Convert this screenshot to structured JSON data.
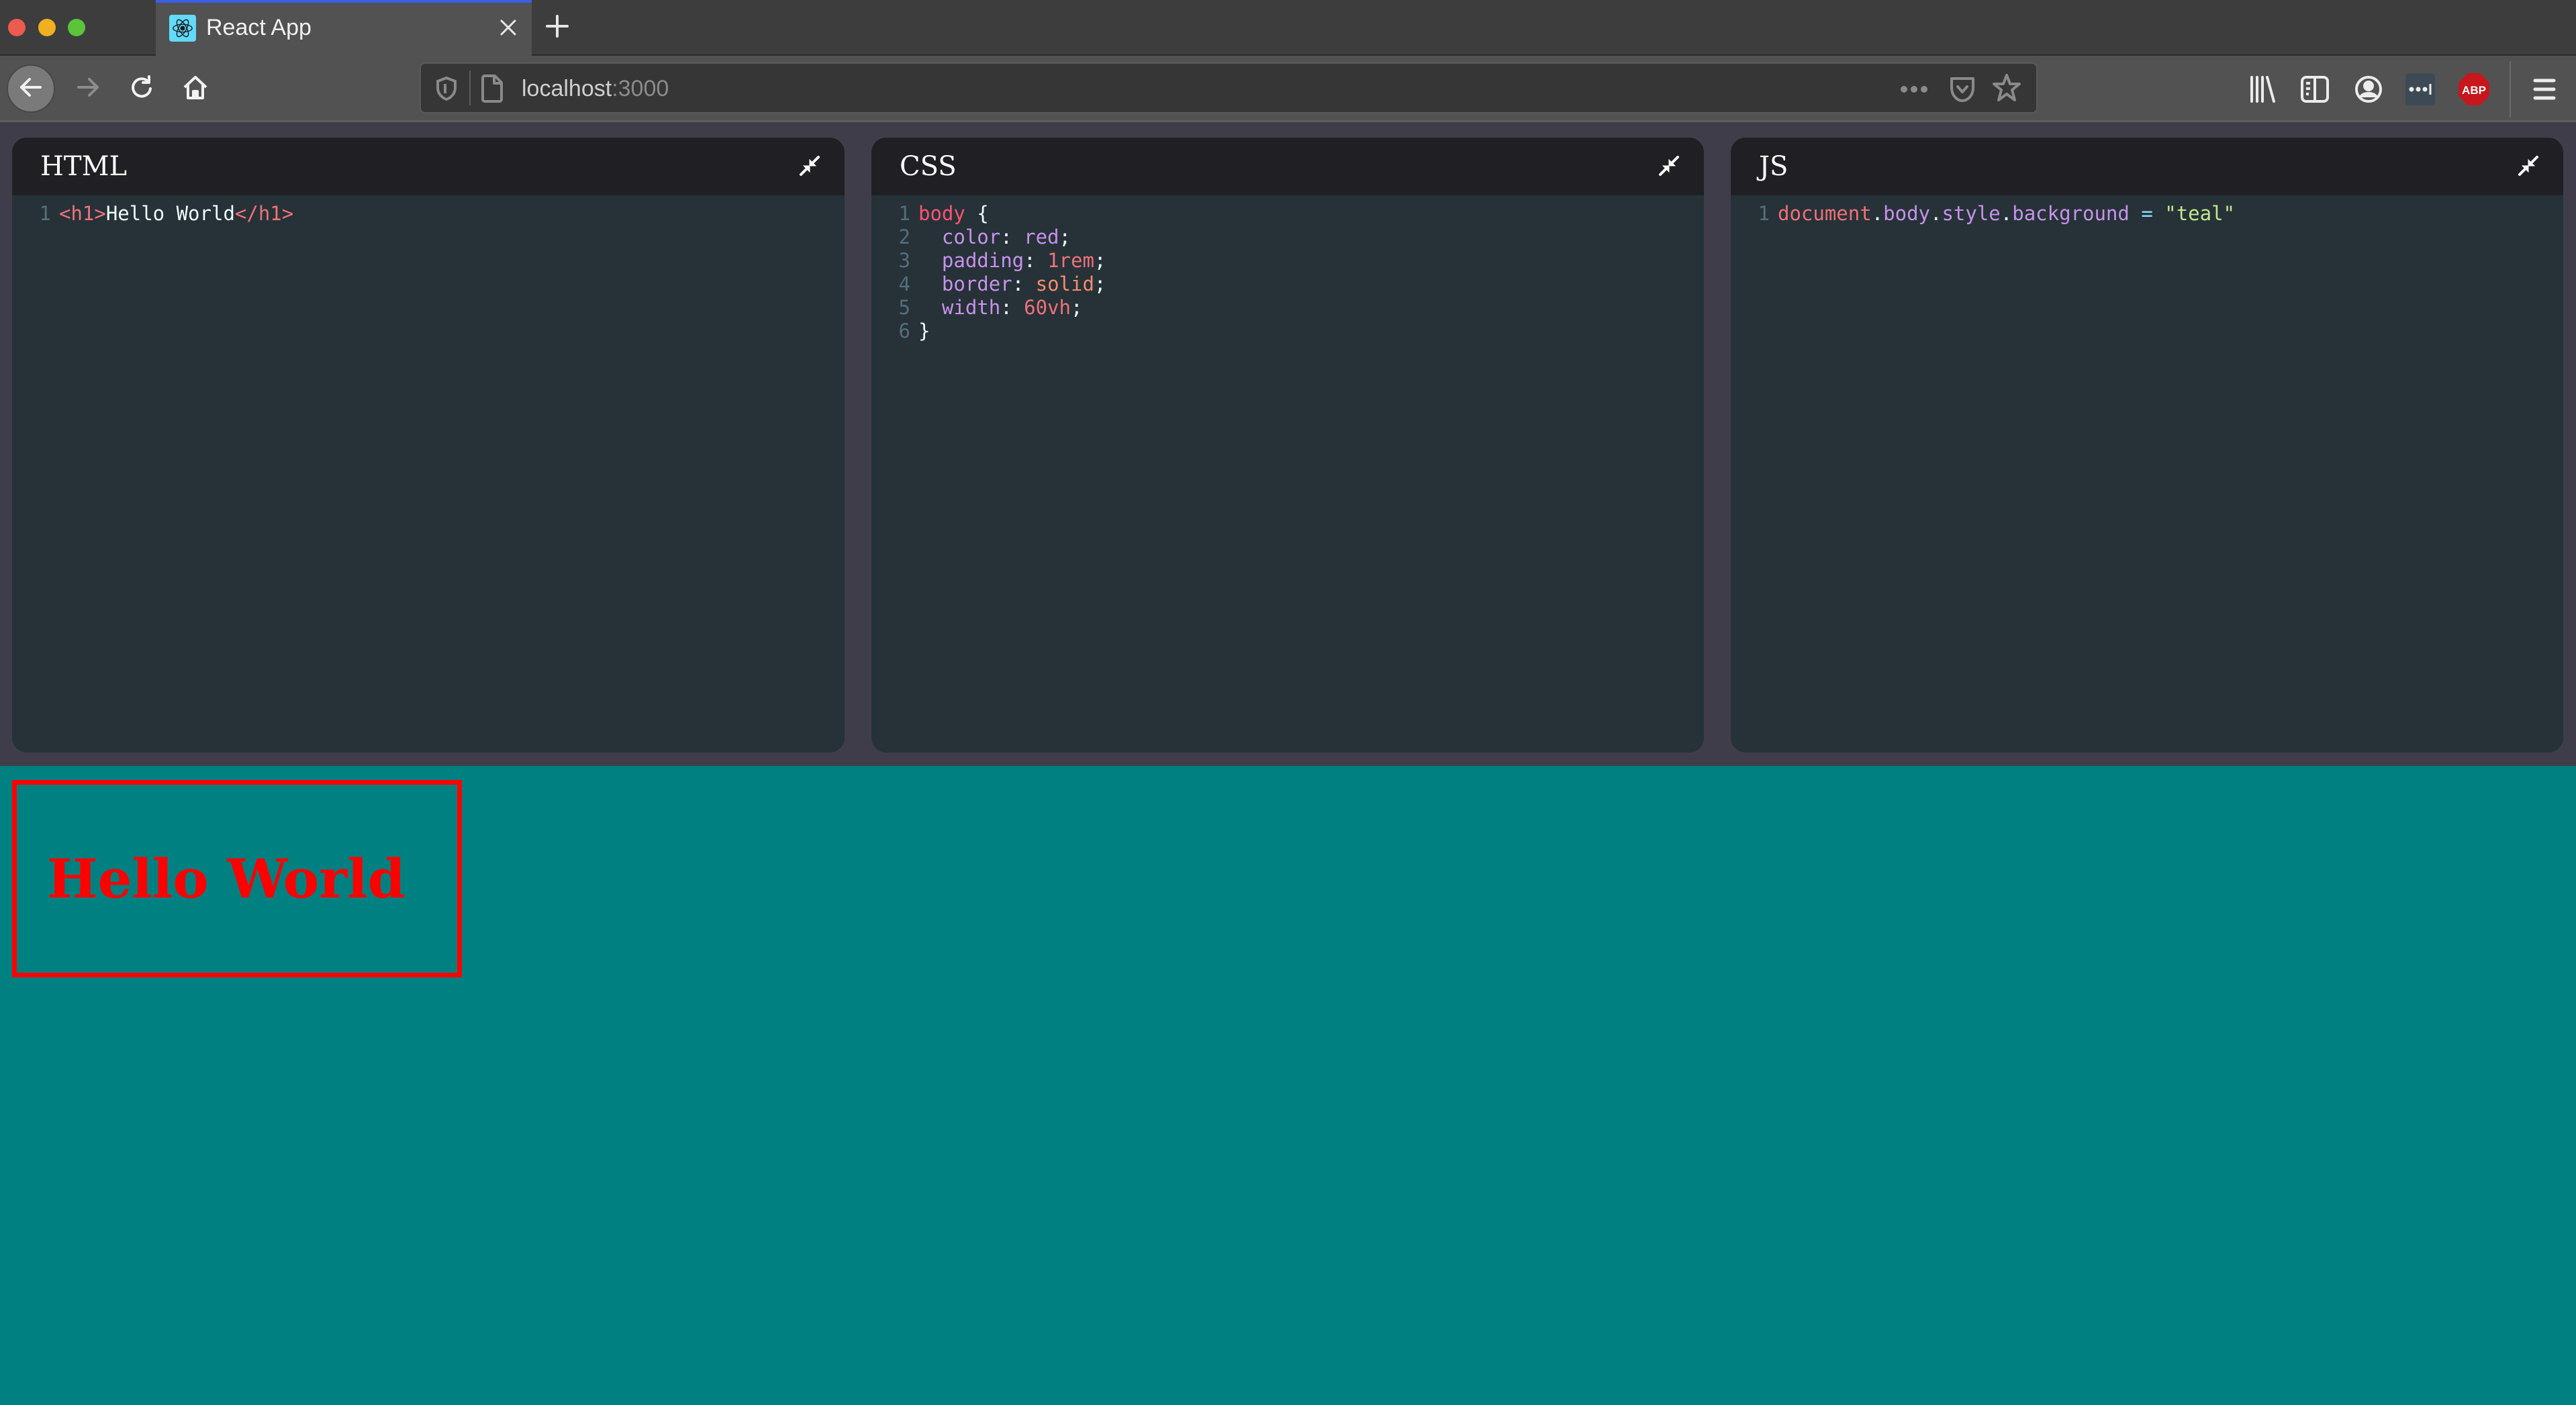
{
  "window": {
    "tab": {
      "title": "React App",
      "favicon": "react-logo-icon"
    },
    "new_tab_icon": "plus-icon",
    "close_tab_icon": "close-icon"
  },
  "navbar": {
    "url_host": "localhost",
    "url_port": ":3000",
    "icons": [
      "back-arrow-icon",
      "forward-arrow-icon",
      "reload-icon",
      "home-icon",
      "shield-icon",
      "page-icon",
      "more-actions-icon",
      "pocket-icon",
      "bookmark-star-icon",
      "library-icon",
      "sidebar-icon",
      "account-icon",
      "extension-icon",
      "adblock-plus-icon",
      "hamburger-menu-icon"
    ],
    "abp_label": "ABP"
  },
  "editors": [
    {
      "title": "HTML",
      "lines": [
        {
          "n": "1",
          "tokens": [
            {
              "t": "<h1>",
              "c": "tok-tag"
            },
            {
              "t": "Hello World",
              "c": "tok-text"
            },
            {
              "t": "</h1>",
              "c": "tok-tag"
            }
          ]
        }
      ]
    },
    {
      "title": "CSS",
      "lines": [
        {
          "n": "1",
          "tokens": [
            {
              "t": "body",
              "c": "tok-selector"
            },
            {
              "t": " {",
              "c": "tok-punc"
            }
          ]
        },
        {
          "n": "2",
          "tokens": [
            {
              "t": "  color",
              "c": "tok-prop"
            },
            {
              "t": ": ",
              "c": "tok-punc"
            },
            {
              "t": "red",
              "c": "tok-prop"
            },
            {
              "t": ";",
              "c": "tok-punc"
            }
          ]
        },
        {
          "n": "3",
          "tokens": [
            {
              "t": "  padding",
              "c": "tok-prop"
            },
            {
              "t": ": ",
              "c": "tok-punc"
            },
            {
              "t": "1rem",
              "c": "tok-num"
            },
            {
              "t": ";",
              "c": "tok-punc"
            }
          ]
        },
        {
          "n": "4",
          "tokens": [
            {
              "t": "  border",
              "c": "tok-prop"
            },
            {
              "t": ": ",
              "c": "tok-punc"
            },
            {
              "t": "solid",
              "c": "tok-kw"
            },
            {
              "t": ";",
              "c": "tok-punc"
            }
          ]
        },
        {
          "n": "5",
          "tokens": [
            {
              "t": "  width",
              "c": "tok-prop"
            },
            {
              "t": ": ",
              "c": "tok-punc"
            },
            {
              "t": "60vh",
              "c": "tok-num"
            },
            {
              "t": ";",
              "c": "tok-punc"
            }
          ]
        },
        {
          "n": "6",
          "tokens": [
            {
              "t": "}",
              "c": "tok-punc"
            }
          ]
        }
      ]
    },
    {
      "title": "JS",
      "lines": [
        {
          "n": "1",
          "tokens": [
            {
              "t": "document",
              "c": "tok-var"
            },
            {
              "t": ".",
              "c": "tok-punc"
            },
            {
              "t": "body",
              "c": "tok-member"
            },
            {
              "t": ".",
              "c": "tok-punc"
            },
            {
              "t": "style",
              "c": "tok-member"
            },
            {
              "t": ".",
              "c": "tok-punc"
            },
            {
              "t": "background",
              "c": "tok-member"
            },
            {
              "t": " = ",
              "c": "tok-op"
            },
            {
              "t": "\"teal\"",
              "c": "tok-str"
            }
          ]
        }
      ]
    }
  ],
  "preview": {
    "heading": "Hello World",
    "background_color": "#008080",
    "text_color": "#ff0000"
  },
  "colors": {
    "tab_accent": "#3b5de8",
    "editor_bg": "#263238",
    "editor_header_bg": "#202024",
    "workspace_bg": "#403d4a"
  }
}
